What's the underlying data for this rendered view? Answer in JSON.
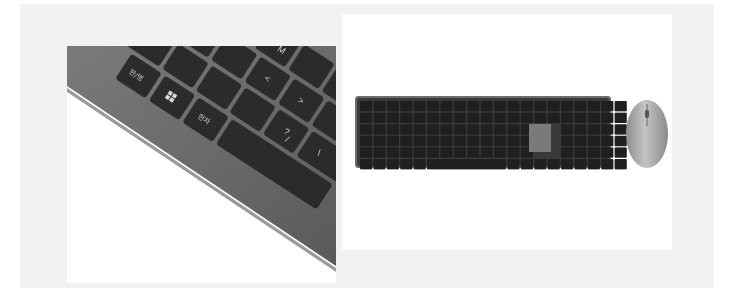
{
  "scene": {
    "left_photo": {
      "subject": "close-up of keyboard corner",
      "key_legends": [
        "M",
        "<",
        ">",
        "?",
        "/",
        "\\",
        "한/영",
        "한자"
      ]
    },
    "right_photo": {
      "subject": "full-size keyboard and mouse"
    },
    "colors": {
      "background": "#f2f2f2",
      "panel": "#ffffff",
      "keyboard_frame": "#6d6d6d",
      "key": "#2b2b2b",
      "key_legend": "#d8d8d8",
      "mouse_body": "#a8a8a8"
    }
  }
}
